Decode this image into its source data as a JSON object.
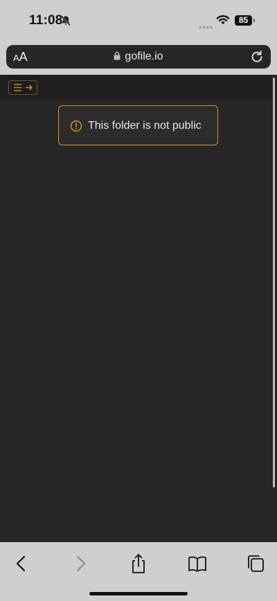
{
  "status_bar": {
    "time": "11:08",
    "battery_level": "85",
    "icons": [
      "bell-slash-icon",
      "cellular-dots-icon",
      "wifi-icon",
      "battery-icon"
    ]
  },
  "browser": {
    "text_size_button": {
      "small": "A",
      "large": "A"
    },
    "url": "gofile.io",
    "icons": [
      "lock-icon",
      "reload-icon"
    ]
  },
  "page": {
    "menu_toggle_icons": [
      "hamburger-icon",
      "arrow-right-icon"
    ],
    "alert": {
      "icon": "exclamation-circle-icon",
      "message": "This folder is not public"
    }
  },
  "toolbar": {
    "buttons": [
      "back-icon",
      "forward-icon",
      "share-icon",
      "bookmarks-icon",
      "tabs-icon"
    ]
  },
  "colors": {
    "accent": "#d9951e",
    "page_bg": "#262626",
    "chrome_bg": "#cfcfcf"
  }
}
